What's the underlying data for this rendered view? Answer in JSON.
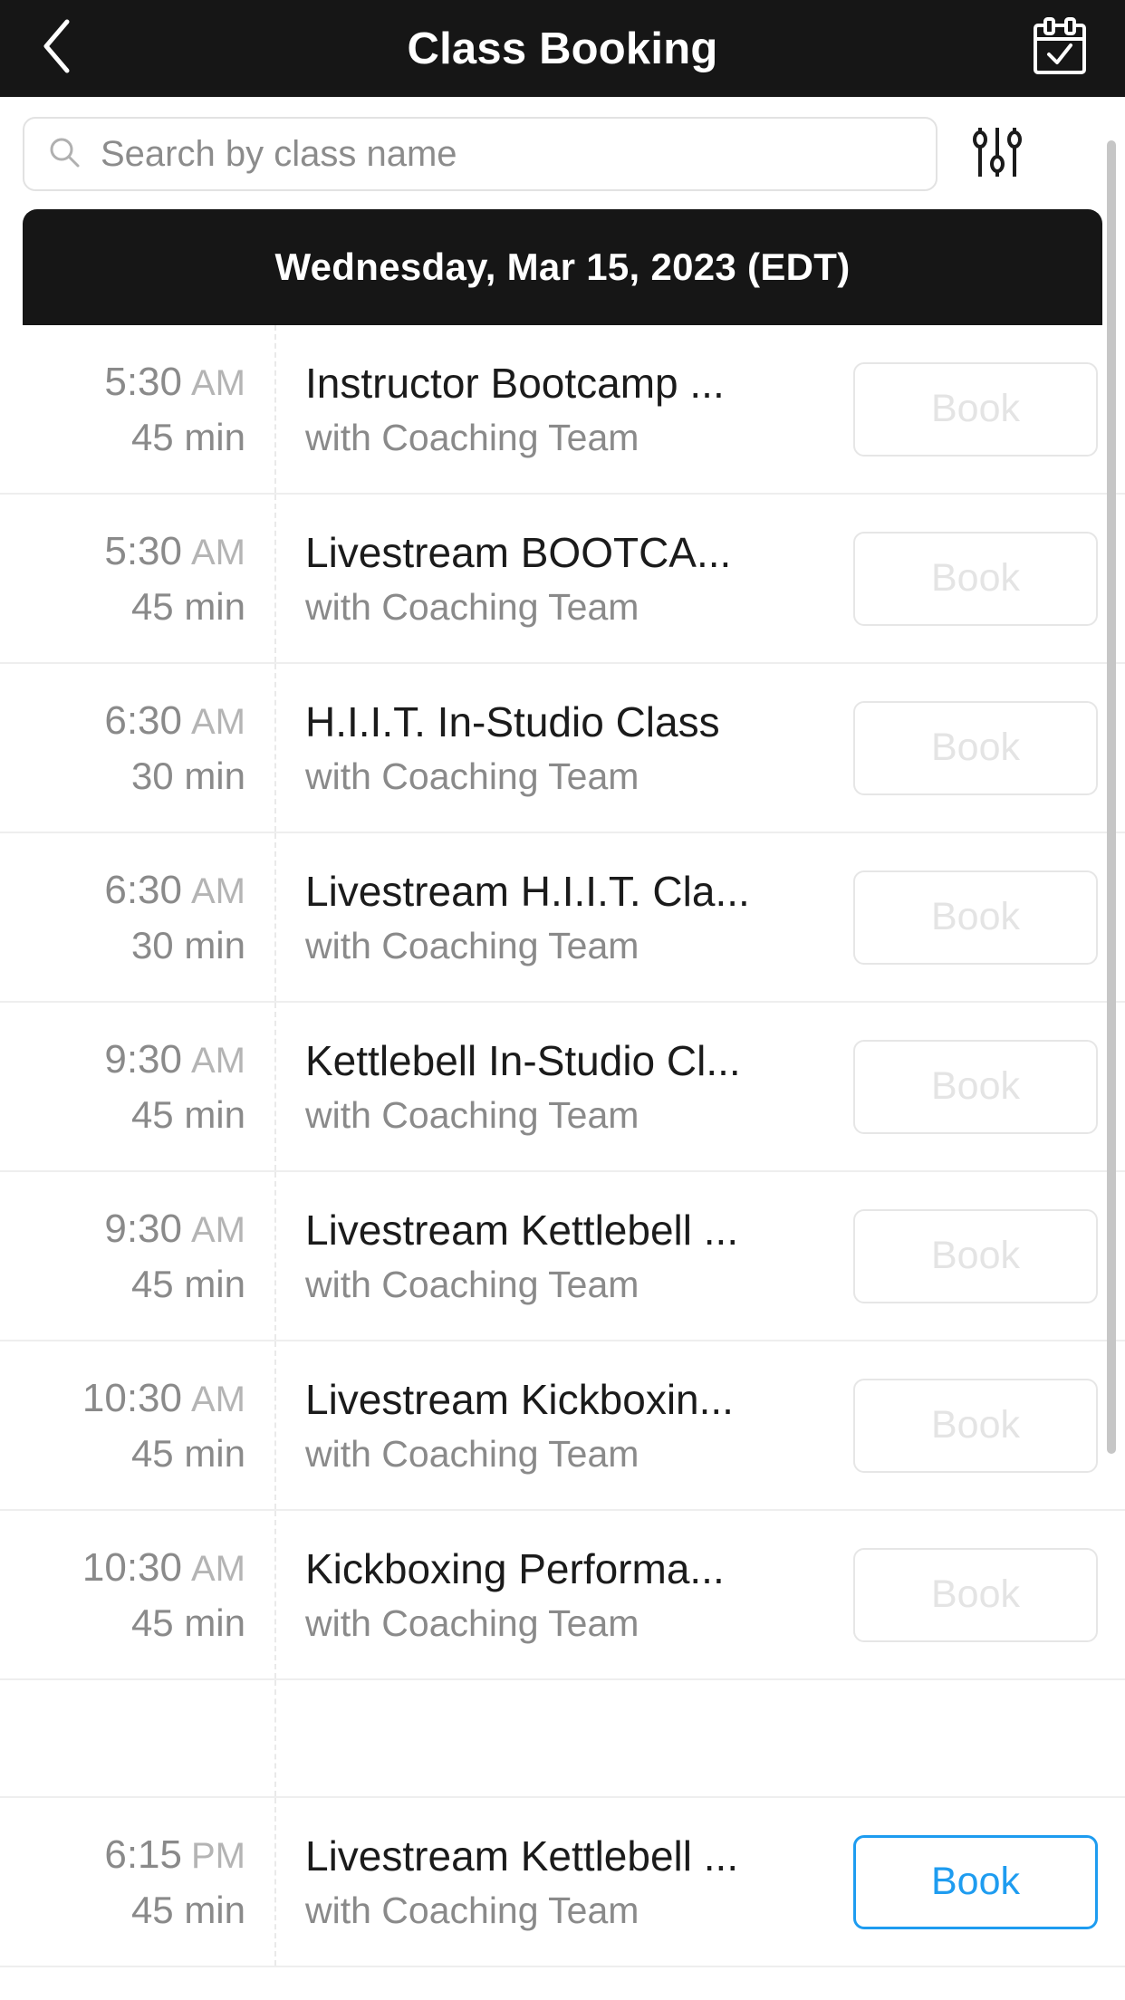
{
  "header": {
    "title": "Class Booking",
    "back_icon": "chevron-left-icon",
    "calendar_icon": "calendar-check-icon"
  },
  "search": {
    "placeholder": "Search by class name",
    "value": "",
    "search_icon": "search-icon",
    "filter_icon": "sliders-filter-icon"
  },
  "date_banner": {
    "label": "Wednesday, Mar 15, 2023 (EDT)"
  },
  "colors": {
    "header_bg": "#161616",
    "banner_bg": "#161616",
    "accent_blue": "#1e9cf0",
    "disabled_border": "#e6e6e6",
    "disabled_text": "#e4e4e4",
    "muted_text": "#8a8a8a",
    "row_divider": "#eeeeee"
  },
  "classes": [
    {
      "time": "5:30",
      "ampm": "AM",
      "duration": "45 min",
      "name": "Instructor Bootcamp ...",
      "instructor": "with Coaching Team",
      "book_label": "Book",
      "book_enabled": false
    },
    {
      "time": "5:30",
      "ampm": "AM",
      "duration": "45 min",
      "name": "Livestream BOOTCA...",
      "instructor": "with Coaching Team",
      "book_label": "Book",
      "book_enabled": false
    },
    {
      "time": "6:30",
      "ampm": "AM",
      "duration": "30 min",
      "name": "H.I.I.T. In-Studio Class",
      "instructor": "with Coaching Team",
      "book_label": "Book",
      "book_enabled": false
    },
    {
      "time": "6:30",
      "ampm": "AM",
      "duration": "30 min",
      "name": "Livestream H.I.I.T. Cla...",
      "instructor": "with Coaching Team",
      "book_label": "Book",
      "book_enabled": false
    },
    {
      "time": "9:30",
      "ampm": "AM",
      "duration": "45 min",
      "name": "Kettlebell In-Studio Cl...",
      "instructor": "with Coaching Team",
      "book_label": "Book",
      "book_enabled": false
    },
    {
      "time": "9:30",
      "ampm": "AM",
      "duration": "45 min",
      "name": "Livestream Kettlebell ...",
      "instructor": "with Coaching Team",
      "book_label": "Book",
      "book_enabled": false
    },
    {
      "time": "10:30",
      "ampm": "AM",
      "duration": "45 min",
      "name": "Livestream Kickboxin...",
      "instructor": "with Coaching Team",
      "book_label": "Book",
      "book_enabled": false
    },
    {
      "time": "10:30",
      "ampm": "AM",
      "duration": "45 min",
      "name": "Kickboxing Performa...",
      "instructor": "with Coaching Team",
      "book_label": "Book",
      "book_enabled": false
    },
    {
      "time": "6:15",
      "ampm": "PM",
      "duration": "45 min",
      "name": "Livestream Kettlebell ...",
      "instructor": "with Coaching Team",
      "book_label": "Book",
      "book_enabled": true
    }
  ]
}
